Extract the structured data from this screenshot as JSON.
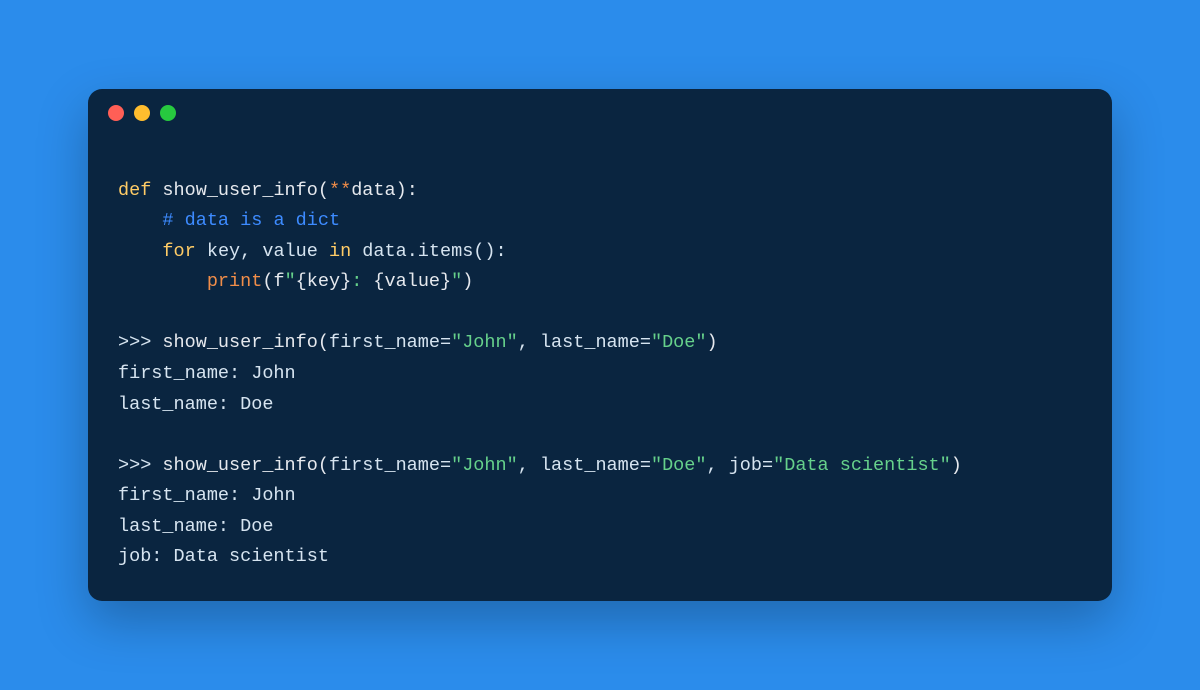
{
  "colors": {
    "page_bg": "#2b8ceb",
    "window_bg": "#0a2540",
    "keyword": "#ffcc66",
    "comment": "#3d8bff",
    "builtin": "#f08d49",
    "string": "#66d18b",
    "text": "#d6e4f0",
    "traffic_red": "#ff5f56",
    "traffic_yellow": "#ffbd2e",
    "traffic_green": "#27c93f"
  },
  "l1": {
    "def": "def",
    "name": "show_user_info",
    "lp": "(",
    "stars": "**",
    "param": "data",
    "rp": "):"
  },
  "l2": {
    "indent": "    ",
    "comment": "# data is a dict"
  },
  "l3": {
    "indent": "    ",
    "for": "for",
    "vars": " key, value ",
    "in": "in",
    "iter": " data.items():"
  },
  "l4": {
    "indent": "        ",
    "fn": "print",
    "lp": "(",
    "f": "f",
    "q1": "\"",
    "b1": "{key}",
    "mid": ": ",
    "b2": "{value}",
    "q2": "\"",
    "rp": ")"
  },
  "blank": " ",
  "l6": {
    "prompt": ">>> ",
    "fn": "show_user_info",
    "lp": "(",
    "k1": "first_name=",
    "v1": "\"John\"",
    "sep1": ", ",
    "k2": "last_name=",
    "v2": "\"Doe\"",
    "rp": ")"
  },
  "l7": {
    "text": "first_name: John"
  },
  "l8": {
    "text": "last_name: Doe"
  },
  "l10": {
    "prompt": ">>> ",
    "fn": "show_user_info",
    "lp": "(",
    "k1": "first_name=",
    "v1": "\"John\"",
    "sep1": ", ",
    "k2": "last_name=",
    "v2": "\"Doe\"",
    "sep2": ", ",
    "k3": "job=",
    "v3": "\"Data scientist\"",
    "rp": ")"
  },
  "l11": {
    "text": "first_name: John"
  },
  "l12": {
    "text": "last_name: Doe"
  },
  "l13": {
    "text": "job: Data scientist"
  }
}
